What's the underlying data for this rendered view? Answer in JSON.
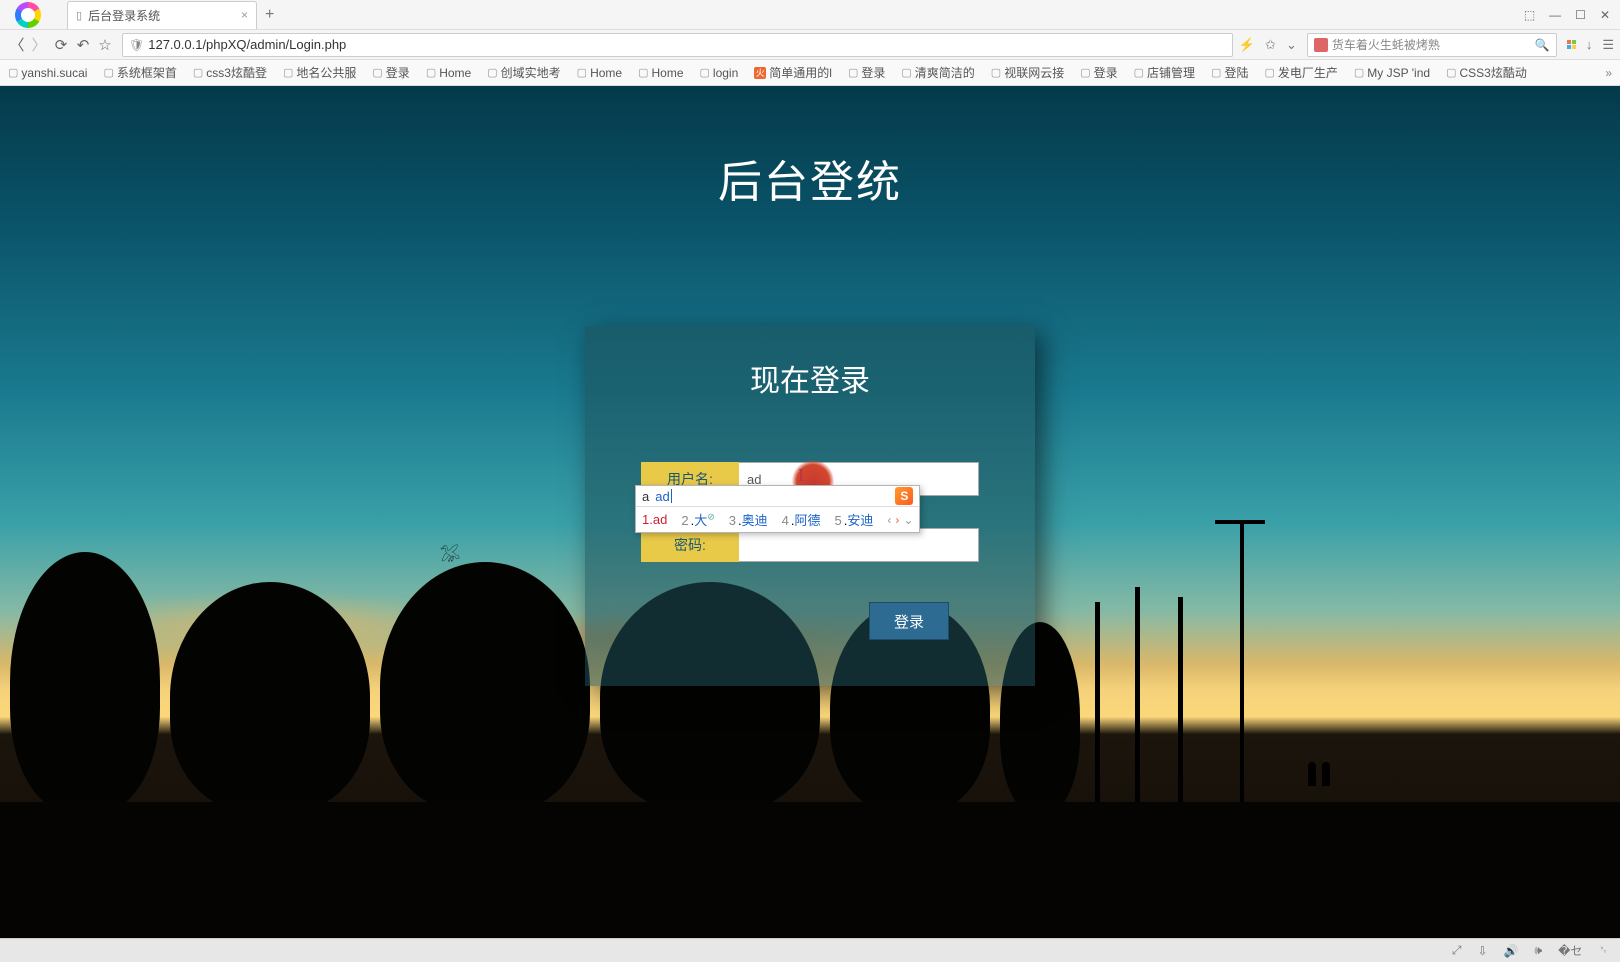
{
  "titlebar": {
    "tab_title": "后台登录系统"
  },
  "addrbar": {
    "url": "127.0.0.1/phpXQ/admin/Login.php",
    "search_placeholder": "货车着火生蚝被烤熟"
  },
  "bookmarks": [
    "yanshi.sucai",
    "系统框架首",
    "css3炫酷登",
    "地名公共服",
    "登录",
    "Home",
    "创域实地考",
    "Home",
    "Home",
    "login",
    "简单通用的l",
    "登录",
    "清爽简洁的",
    "视联网云接",
    "登录",
    "店铺管理",
    "登陆",
    "发电厂生产",
    "My JSP 'ind",
    "CSS3炫酷动"
  ],
  "page": {
    "heading": "后台登统",
    "card_title": "现在登录",
    "user_label": "用户名:",
    "user_value": "ad",
    "pass_label": "密码:",
    "pass_value": "",
    "login_btn": "登录"
  },
  "ime": {
    "prefix": "a",
    "composition": "ad",
    "candidates": [
      {
        "n": "1",
        "t": "ad"
      },
      {
        "n": "2",
        "t": "大",
        "badge": true
      },
      {
        "n": "3",
        "t": "奥迪"
      },
      {
        "n": "4",
        "t": "阿德"
      },
      {
        "n": "5",
        "t": "安迪"
      }
    ]
  }
}
